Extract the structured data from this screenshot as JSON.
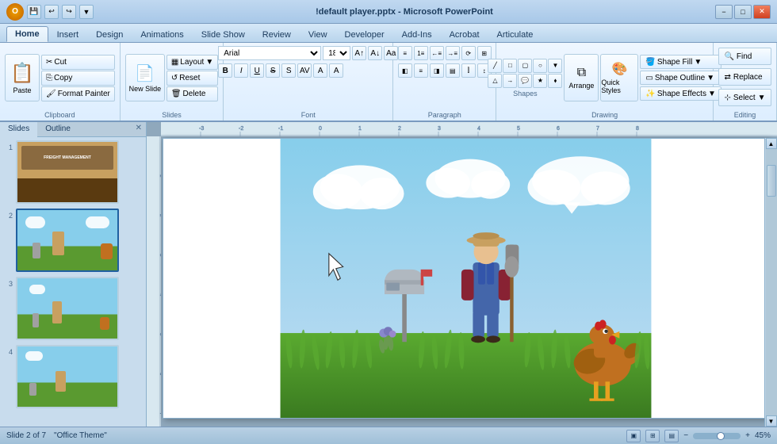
{
  "titlebar": {
    "title": "!default player.pptx - Microsoft PowerPoint",
    "office_btn_label": "O",
    "quick_access": [
      "save",
      "undo",
      "redo",
      "customize"
    ],
    "win_btns": [
      "−",
      "□",
      "✕"
    ]
  },
  "tabs": [
    {
      "id": "home",
      "label": "Home",
      "active": true
    },
    {
      "id": "insert",
      "label": "Insert"
    },
    {
      "id": "design",
      "label": "Design"
    },
    {
      "id": "animations",
      "label": "Animations"
    },
    {
      "id": "slideshow",
      "label": "Slide Show"
    },
    {
      "id": "review",
      "label": "Review"
    },
    {
      "id": "view",
      "label": "View"
    },
    {
      "id": "developer",
      "label": "Developer"
    },
    {
      "id": "addins",
      "label": "Add-Ins"
    },
    {
      "id": "acrobat",
      "label": "Acrobat"
    },
    {
      "id": "articulate",
      "label": "Articulate"
    }
  ],
  "ribbon": {
    "groups": [
      {
        "id": "clipboard",
        "label": "Clipboard",
        "paste_label": "Paste",
        "cut_label": "Cut",
        "copy_label": "Copy",
        "format_painter_label": "Format Painter"
      },
      {
        "id": "slides",
        "label": "Slides",
        "new_slide_label": "New Slide",
        "layout_label": "Layout",
        "reset_label": "Reset",
        "delete_label": "Delete"
      },
      {
        "id": "font",
        "label": "Font",
        "font_name": "Arial",
        "font_size": "18",
        "bold": "B",
        "italic": "I",
        "underline": "U",
        "strikethrough": "S",
        "shadow": "S"
      },
      {
        "id": "paragraph",
        "label": "Paragraph"
      },
      {
        "id": "drawing",
        "label": "Drawing",
        "shapes_label": "Shapes",
        "arrange_label": "Arrange",
        "quick_styles_label": "Quick Styles",
        "shape_fill_label": "Shape Fill",
        "shape_outline_label": "Shape Outline",
        "shape_effects_label": "Shape Effects"
      },
      {
        "id": "editing",
        "label": "Editing",
        "find_label": "Find",
        "replace_label": "Replace",
        "select_label": "Select"
      }
    ]
  },
  "slides_panel": {
    "tab_slides": "Slides",
    "tab_outline": "Outline",
    "slides": [
      {
        "num": "1",
        "active": false
      },
      {
        "num": "2",
        "active": true
      },
      {
        "num": "3",
        "active": false
      },
      {
        "num": "4",
        "active": false
      }
    ]
  },
  "status_bar": {
    "slide_info": "Slide 2 of 7",
    "theme": "\"Office Theme\"",
    "zoom": "45%",
    "view_normal": "▣",
    "view_slide_sorter": "⊞",
    "view_reading": "▤"
  }
}
